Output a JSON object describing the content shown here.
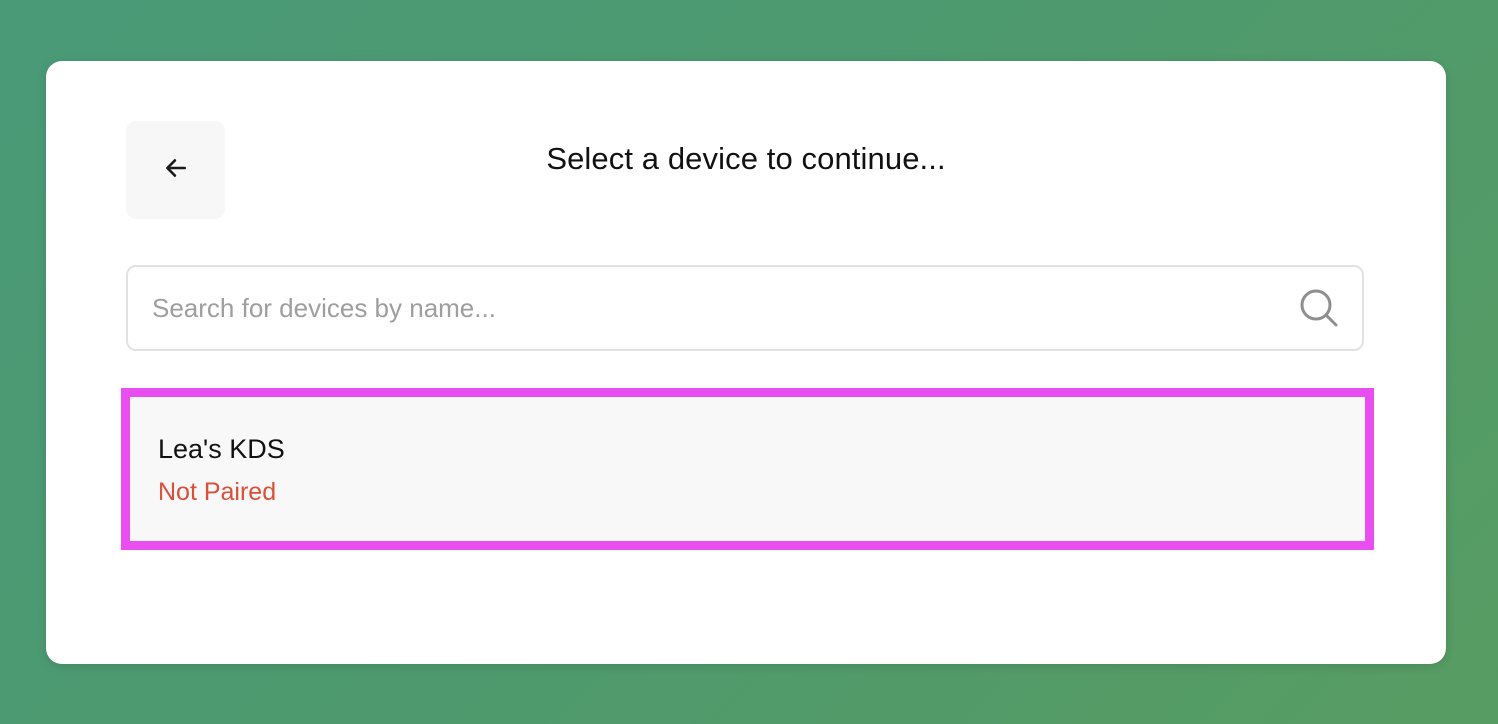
{
  "header": {
    "title": "Select a device to continue..."
  },
  "search": {
    "placeholder": "Search for devices by name...",
    "value": ""
  },
  "devices": [
    {
      "name": "Lea's KDS",
      "status": "Not Paired",
      "status_color": "#d9503a"
    }
  ],
  "icons": {
    "back": "arrow-left-icon",
    "search": "search-icon"
  },
  "colors": {
    "highlight_border": "#e94ff0",
    "background_gradient_start": "#4a9a78",
    "background_gradient_end": "#579c62"
  }
}
